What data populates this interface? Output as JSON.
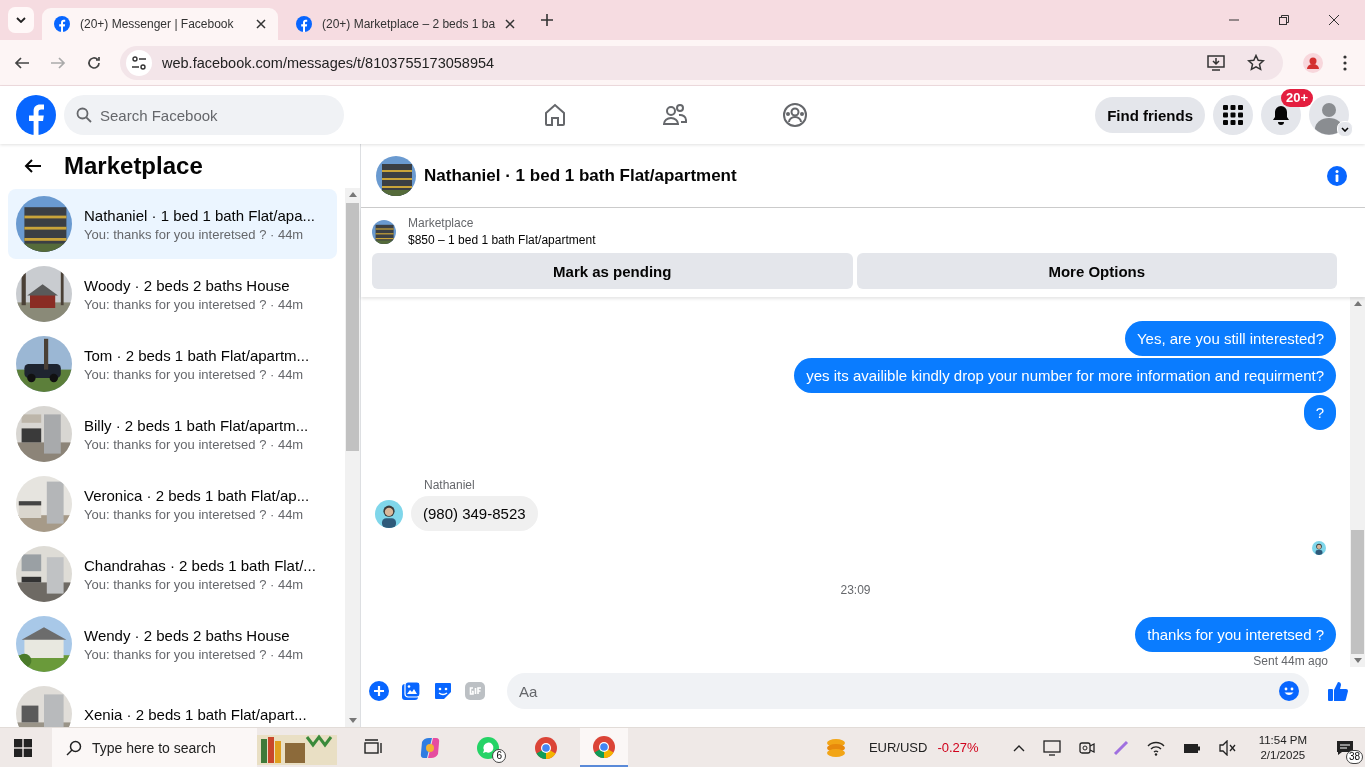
{
  "browser": {
    "tabs": [
      {
        "title": "(20+) Messenger | Facebook",
        "selected": true
      },
      {
        "title": "(20+) Marketplace – 2 beds 1 ba",
        "selected": false
      }
    ],
    "url": "web.facebook.com/messages/t/8103755173058954"
  },
  "header": {
    "search": {
      "placeholder": "Search Facebook"
    },
    "find_friends": "Find friends",
    "notification_badge": "20+"
  },
  "sidebar": {
    "title": "Marketplace",
    "conversations": [
      {
        "name": "Nathaniel · 1 bed 1 bath Flat/apa...",
        "preview": "You: thanks for you interetsed ? · 44m",
        "selected": true
      },
      {
        "name": "Woody · 2 beds 2 baths House",
        "preview": "You: thanks for you interetsed ? · 44m",
        "selected": false
      },
      {
        "name": "Tom · 2 beds 1 bath Flat/apartm...",
        "preview": "You: thanks for you interetsed ? · 44m",
        "selected": false
      },
      {
        "name": "Billy · 2 beds 1 bath Flat/apartm...",
        "preview": "You: thanks for you interetsed ? · 44m",
        "selected": false
      },
      {
        "name": "Veronica · 2 beds 1 bath Flat/ap...",
        "preview": "You: thanks for you interetsed ? · 44m",
        "selected": false
      },
      {
        "name": "Chandrahas · 2 beds 1 bath Flat/...",
        "preview": "You: thanks for you interetsed ? · 44m",
        "selected": false
      },
      {
        "name": "Wendy · 2 beds 2 baths House",
        "preview": "You: thanks for you interetsed ? · 44m",
        "selected": false
      },
      {
        "name": "Xenia · 2 beds 1 bath Flat/apart...",
        "selected": false
      }
    ]
  },
  "chat": {
    "title": "Nathaniel · 1 bed 1 bath Flat/apartment",
    "listing": {
      "label": "Marketplace",
      "price": "$850 – 1 bed 1 bath Flat/apartment"
    },
    "actions": [
      "Mark as pending",
      "More Options"
    ],
    "messages": [
      {
        "kind": "sent",
        "text": "Yes, are you still interested?"
      },
      {
        "kind": "sent",
        "text": "yes its availible kindly drop your number for more information and requirment?"
      },
      {
        "kind": "sent",
        "text": "?"
      },
      {
        "kind": "received",
        "sender": "Nathaniel",
        "text": "(980) 349-8523"
      },
      {
        "kind": "seen"
      },
      {
        "kind": "time",
        "text": "23:09"
      },
      {
        "kind": "sent",
        "text": "thanks for you interetsed ?"
      },
      {
        "kind": "status",
        "text": "Sent 44m ago"
      }
    ],
    "composer": {
      "placeholder": "Aa"
    }
  },
  "taskbar": {
    "search_placeholder": "Type here to search",
    "whatsapp_badge": "6",
    "ticker": {
      "symbol": "EUR/USD",
      "change": "-0.27%"
    },
    "time": "11:54 PM",
    "date": "2/1/2025",
    "notifications": "38"
  }
}
